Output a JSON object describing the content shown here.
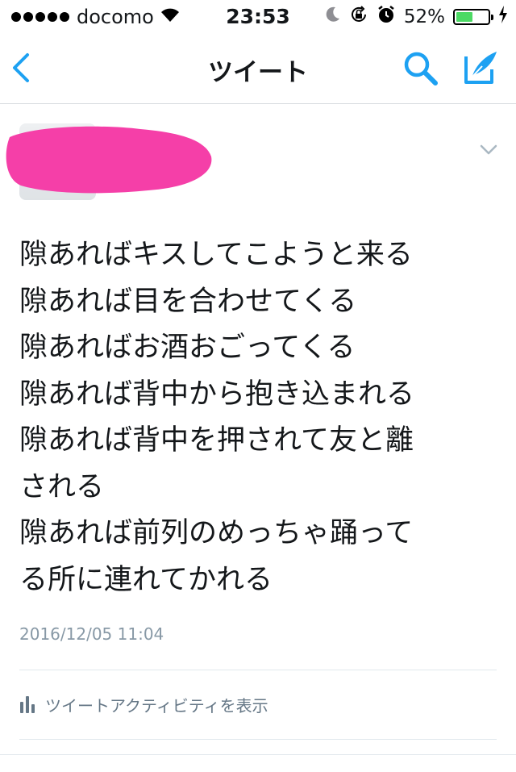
{
  "status_bar": {
    "carrier": "docomo",
    "time": "23:53",
    "battery_percent": "52%",
    "battery_level": 0.52,
    "icons": [
      "signal-dots-icon",
      "wifi-icon",
      "moon-icon",
      "rotation-lock-icon",
      "alarm-icon",
      "battery-icon",
      "charging-bolt-icon"
    ]
  },
  "nav": {
    "title": "ツイート",
    "icons": [
      "back-chevron-icon",
      "search-icon",
      "compose-tweet-icon"
    ],
    "accent_color": "#1da1f2"
  },
  "tweet": {
    "lines": [
      "隙あればキスしてこようと来る",
      "隙あれば目を合わせてくる",
      "隙あればお酒おごってくる",
      "隙あれば背中から抱き込まれる",
      "隙あれば背中を押されて友と離",
      "される",
      "隙あれば前列のめっちゃ踊って",
      "る所に連れてかれる"
    ],
    "timestamp": "2016/12/05 11:04",
    "redaction_color": "#f53fa8"
  },
  "activity": {
    "label": "ツイートアクティビティを表示",
    "icon": "bar-chart-icon"
  }
}
